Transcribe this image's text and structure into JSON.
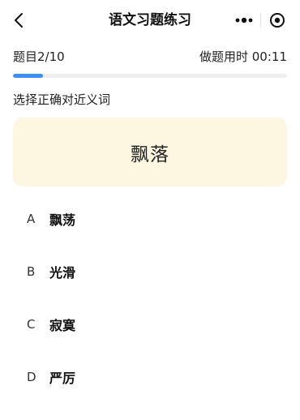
{
  "nav": {
    "title": "语文习题练习",
    "back_icon": "chevron-left-icon",
    "more_icon": "more-dots-icon",
    "close_icon": "target-close-icon"
  },
  "progress": {
    "question_label": "题目2/10",
    "timer_label": "做题用时 00:11",
    "fill_fraction": 0.11,
    "fill_color": "#3d8ef7",
    "track_color": "#eeeeee"
  },
  "question": {
    "instruction": "选择正确对近义词",
    "word": "飘落",
    "card_color": "#fdf6e1"
  },
  "options": [
    {
      "letter": "A",
      "text": "飘荡"
    },
    {
      "letter": "B",
      "text": "光滑"
    },
    {
      "letter": "C",
      "text": "寂寞"
    },
    {
      "letter": "D",
      "text": "严厉"
    }
  ]
}
